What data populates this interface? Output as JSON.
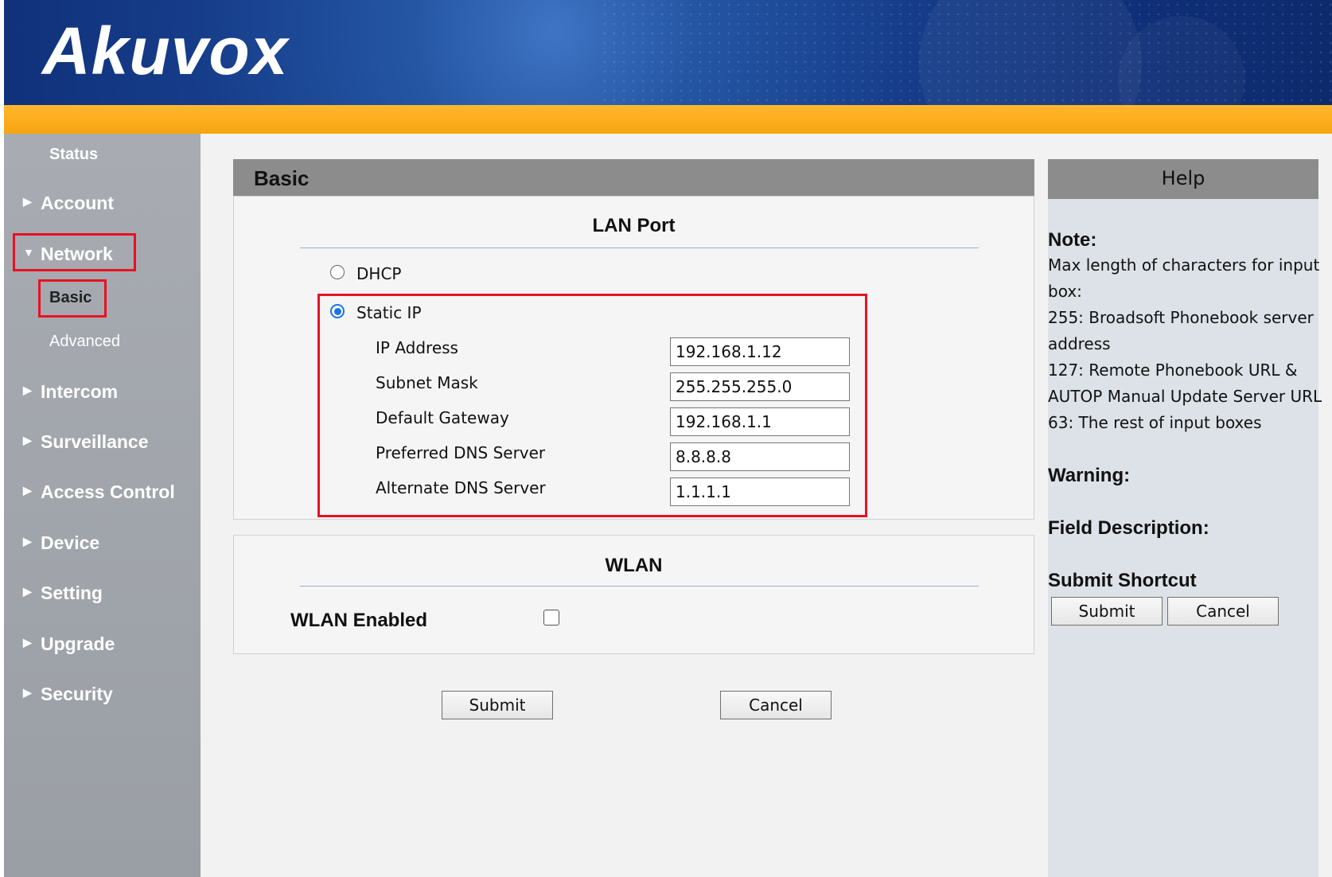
{
  "header": {
    "logo": "Akuvox"
  },
  "sidebar": {
    "status": "Status",
    "items": [
      {
        "label": "Account",
        "arrow": "▶"
      },
      {
        "label": "Network",
        "arrow": "▼"
      },
      {
        "label": "Intercom",
        "arrow": "▶"
      },
      {
        "label": "Surveillance",
        "arrow": "▶"
      },
      {
        "label": "Access Control",
        "arrow": "▶"
      },
      {
        "label": "Device",
        "arrow": "▶"
      },
      {
        "label": "Setting",
        "arrow": "▶"
      },
      {
        "label": "Upgrade",
        "arrow": "▶"
      },
      {
        "label": "Security",
        "arrow": "▶"
      }
    ],
    "network_sub": [
      "Basic",
      "Advanced"
    ]
  },
  "main": {
    "panel_title": "Basic",
    "lan": {
      "title": "LAN Port",
      "dhcp_label": "DHCP",
      "static_label": "Static IP",
      "mode": "Static IP",
      "fields": [
        {
          "label": "IP Address",
          "value": "192.168.1.12"
        },
        {
          "label": "Subnet Mask",
          "value": "255.255.255.0"
        },
        {
          "label": "Default Gateway",
          "value": "192.168.1.1"
        },
        {
          "label": "Preferred DNS Server",
          "value": "8.8.8.8"
        },
        {
          "label": "Alternate DNS Server",
          "value": "1.1.1.1"
        }
      ]
    },
    "wlan": {
      "title": "WLAN",
      "enabled_label": "WLAN Enabled",
      "enabled": false
    },
    "submit_label": "Submit",
    "cancel_label": "Cancel"
  },
  "help": {
    "title": "Help",
    "note_heading": "Note:",
    "note_lines": [
      "Max length of characters for input",
      "box:",
      "255: Broadsoft Phonebook server",
      "address",
      "127: Remote Phonebook URL &",
      "AUTOP Manual Update Server URL",
      "63: The rest of input boxes"
    ],
    "warning_heading": "Warning:",
    "field_desc_heading": "Field Description:",
    "shortcut_heading": "Submit Shortcut",
    "submit_label": "Submit",
    "cancel_label": "Cancel"
  },
  "colors": {
    "header_blue": "#163d8a",
    "orange": "#f7a50f",
    "sidebar_gray": "#9a9ea5",
    "panel_gray": "#8c8c8c",
    "highlight_red": "#e81123",
    "radio_blue": "#1a73e8"
  }
}
